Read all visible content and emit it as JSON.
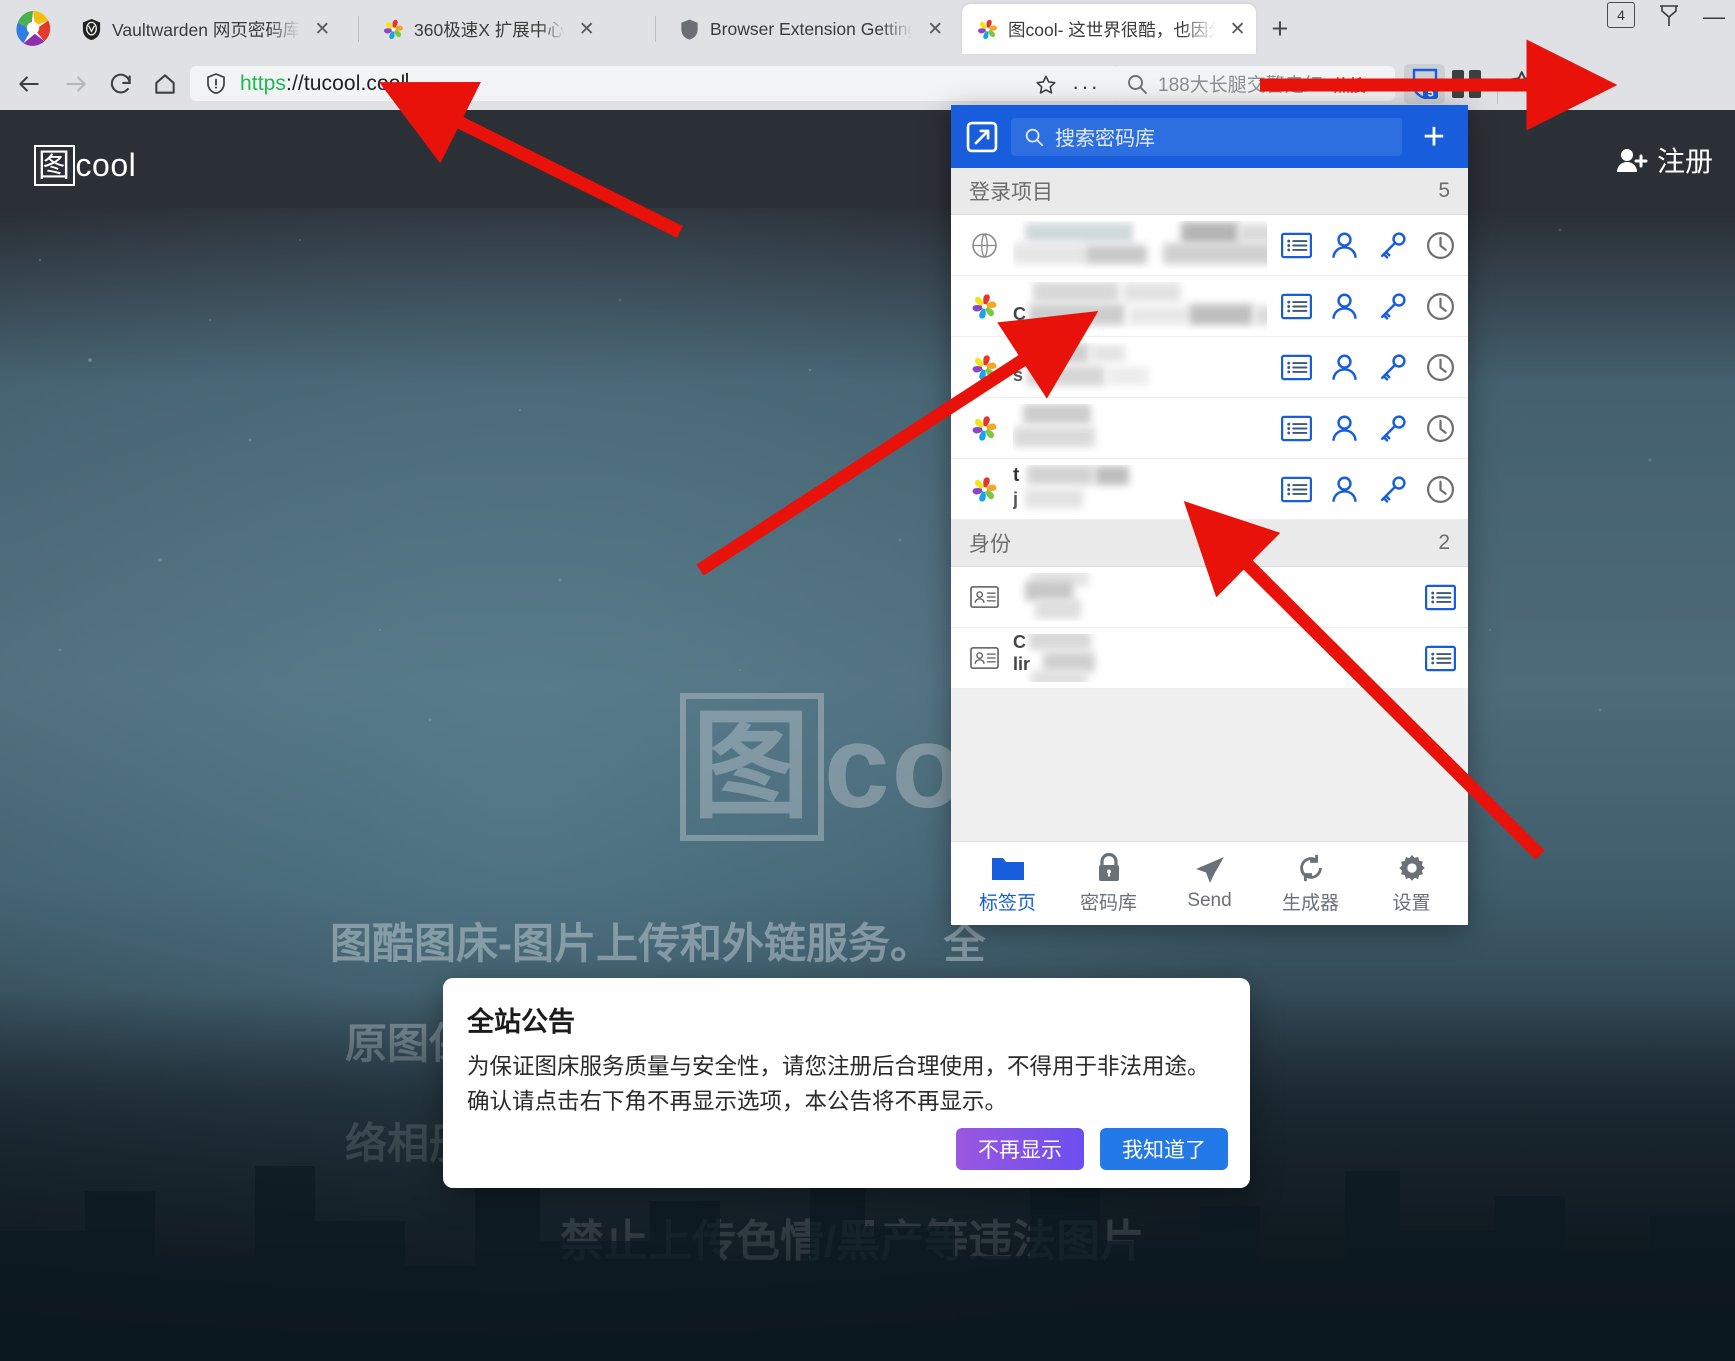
{
  "window": {
    "tab_count_badge": "4",
    "tray_icon": "tray-icon",
    "minimize_label": "—"
  },
  "tabs": [
    {
      "title": "Vaultwarden 网页密码库",
      "icon": "shield-icon",
      "active": false,
      "close": "✕"
    },
    {
      "title": "360极速X 扩展中心",
      "icon": "pinwheel-icon",
      "active": false,
      "close": "✕"
    },
    {
      "title": "Browser Extension Getting",
      "icon": "shield-icon",
      "active": false,
      "close": "✕"
    },
    {
      "title": "图cool- 这世界很酷，也因分",
      "icon": "pinwheel-icon",
      "active": true,
      "close": "✕"
    }
  ],
  "newtab_label": "+",
  "toolbar": {
    "back_icon": "back-arrow-icon",
    "forward_icon": "forward-arrow-icon",
    "reload_icon": "reload-icon",
    "home_icon": "home-icon",
    "security_icon": "shield-warning-icon",
    "url_scheme": "https",
    "url_separator": "://",
    "url_host": "tucool.cool",
    "bookmark_icon": "star-icon",
    "more_icon": "ellipsis-icon",
    "search_placeholder": "188大长腿交警走红",
    "search_badge": "热搜",
    "extension_icon": "bitwarden-extension-icon",
    "extension_badge": "5",
    "extensions_grid_icon": "extensions-grid-icon",
    "favorites_icon": "favorites-star-icon",
    "profile_icon": "profile-icon"
  },
  "site": {
    "logo_boxed": "图",
    "logo_rest": "cool",
    "register_label": "注册",
    "register_icon": "user-add-icon",
    "hero_boxed": "图",
    "hero_rest": "coo",
    "hero_lines": [
      "图酷图床-图片上传和外链服务。  全",
      "原图保",
      "络相册",
      "禁止上传色情/黑产等违法图片"
    ]
  },
  "announcement": {
    "title": "全站公告",
    "body": "为保证图床服务质量与安全性，请您注册后合理使用，不得用于非法用途。 确认请点击右下角不再显示选项，本公告将不再显示。",
    "dismiss_label": "不再显示",
    "ok_label": "我知道了",
    "dismiss_color": "#9b57e0",
    "ok_color": "#2379e8"
  },
  "extension_popup": {
    "header": {
      "popout_icon": "popout-icon",
      "search_icon": "search-icon",
      "search_placeholder": "搜索密码库",
      "add_label": "+",
      "bg_color": "#175ddc"
    },
    "groups": [
      {
        "label": "登录项目",
        "count": "5",
        "items": [
          {
            "icon": "globe-icon",
            "redacted": true,
            "lead": "",
            "actions": [
              "list-icon",
              "person-icon",
              "key-icon",
              "clock-icon"
            ]
          },
          {
            "icon": "pinwheel-icon",
            "redacted": true,
            "lead": "",
            "subtext_tail": "9...",
            "actions": [
              "list-icon",
              "person-icon",
              "key-icon",
              "clock-icon"
            ]
          },
          {
            "icon": "pinwheel-icon",
            "redacted": true,
            "lead": "",
            "actions": [
              "list-icon",
              "person-icon",
              "key-icon",
              "clock-icon"
            ]
          },
          {
            "icon": "pinwheel-icon",
            "redacted": true,
            "lead": "",
            "actions": [
              "list-icon",
              "person-icon",
              "key-icon",
              "clock-icon"
            ]
          },
          {
            "icon": "pinwheel-icon",
            "redacted": true,
            "lead": "t",
            "actions": [
              "list-icon",
              "person-icon",
              "key-icon",
              "clock-icon"
            ]
          }
        ]
      },
      {
        "label": "身份",
        "count": "2",
        "items": [
          {
            "icon": "id-card-icon",
            "redacted": true,
            "lead": "",
            "actions": [
              "list-icon"
            ]
          },
          {
            "icon": "id-card-icon",
            "redacted": true,
            "lead": "lir",
            "actions": [
              "list-icon"
            ]
          }
        ]
      }
    ],
    "bottom_tabs": [
      {
        "label": "标签页",
        "icon": "folder-icon",
        "active": true
      },
      {
        "label": "密码库",
        "icon": "lock-icon",
        "active": false
      },
      {
        "label": "Send",
        "icon": "send-icon",
        "active": false
      },
      {
        "label": "生成器",
        "icon": "refresh-icon",
        "active": false
      },
      {
        "label": "设置",
        "icon": "gear-icon",
        "active": false
      }
    ],
    "accent_color": "#175ddc"
  },
  "annotations": {
    "arrow_color": "#e8120b",
    "arrows": [
      {
        "name": "arrow-to-address-bar"
      },
      {
        "name": "arrow-to-vault-list"
      },
      {
        "name": "arrow-to-vault-item"
      },
      {
        "name": "arrow-to-extension-button"
      }
    ]
  }
}
